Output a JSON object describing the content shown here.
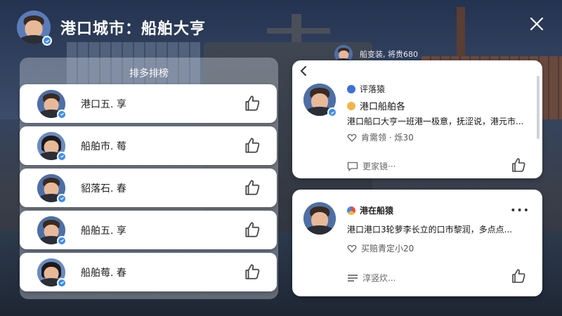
{
  "window": {
    "title": "港口城市：船舶大亨"
  },
  "leaderboard": {
    "header": "排多排榜",
    "items": [
      {
        "name": "港口五. 享",
        "avatar": "male"
      },
      {
        "name": "船舶市. 莓",
        "avatar": "female"
      },
      {
        "name": "貂落石. 春",
        "avatar": "male"
      },
      {
        "name": "船舶五. 享",
        "avatar": "male"
      },
      {
        "name": "船舶莓. 春",
        "avatar": "female"
      }
    ]
  },
  "peek": {
    "text": "船变装, 将贵680"
  },
  "posts": [
    {
      "author": "评落猿",
      "subtitle": "港口船舶各",
      "content": "港口船口大亨一班港一极意，抚涩说，港元市...",
      "meta": "肯需领 · 烁30",
      "footer": "更家镜···"
    },
    {
      "author": "港在船猿",
      "content": "港口港口3轮萝李长立的口市黎润，多点点...",
      "meta": "买赔青定小20",
      "footer": "淳竖炊..."
    }
  ],
  "colors": {
    "badge": "#3c8df0",
    "card_bg": "#ffffff",
    "title_text": "#ffffff"
  }
}
